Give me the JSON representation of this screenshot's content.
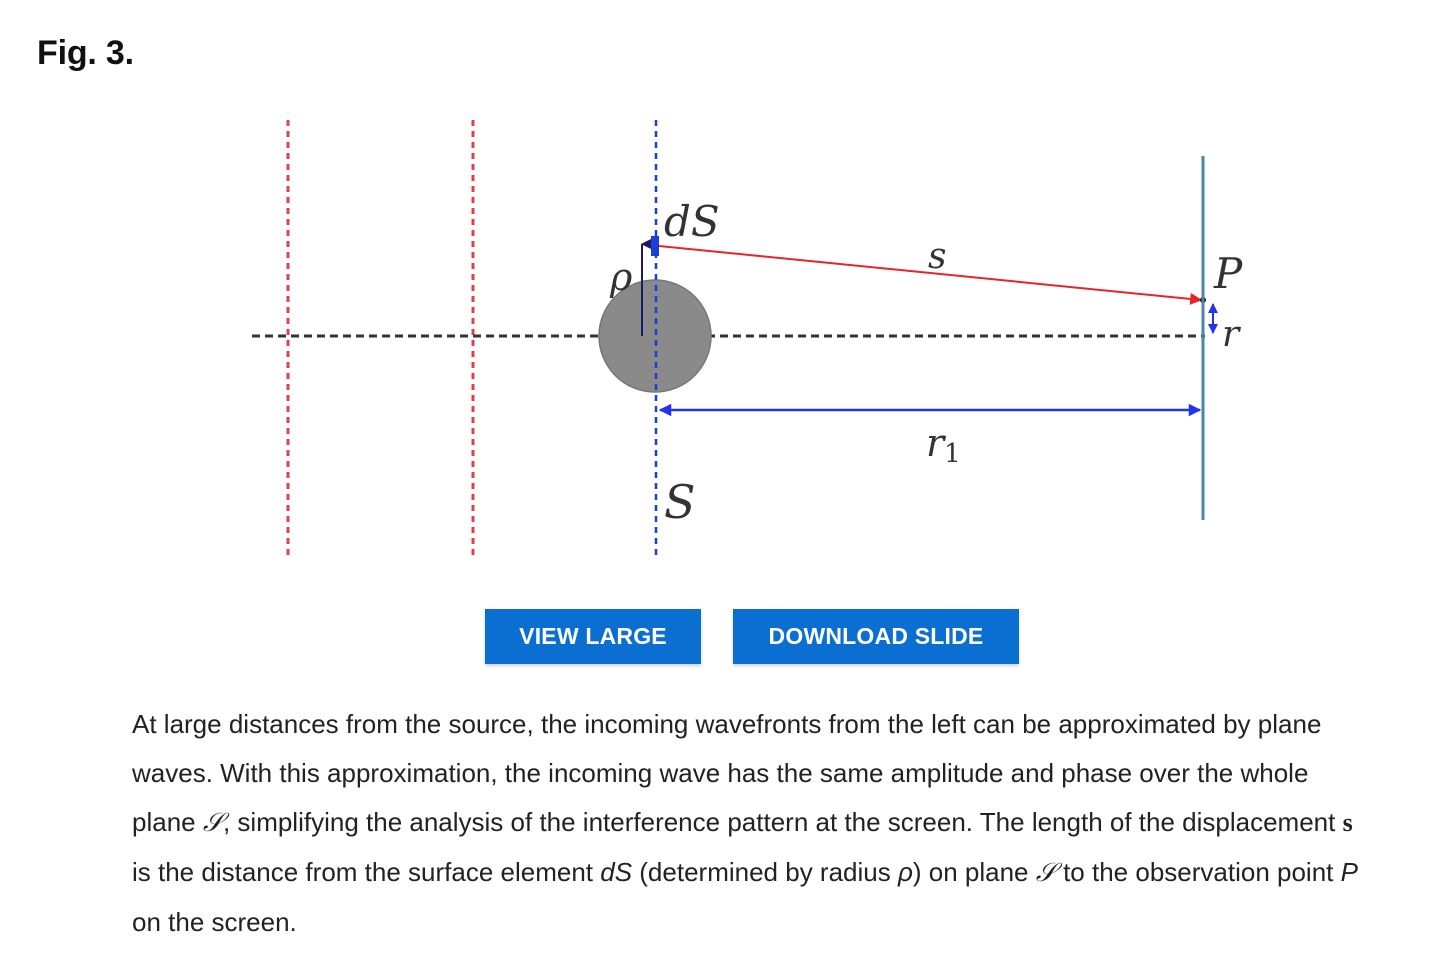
{
  "figure": {
    "title": "Fig. 3.",
    "labels": {
      "dS": "dS",
      "s": "s",
      "P": "P",
      "rho": "ρ",
      "r": "r",
      "r1": "r",
      "r1_sub": "1",
      "S": "S"
    },
    "colors": {
      "wavefront": "#e0404a",
      "axis": "#333333",
      "plane": "#1a3fd6",
      "ray": "#e8232a",
      "distance": "#2233ee",
      "screen": "#4a86a8",
      "obstacle": "#8a8a8a"
    }
  },
  "buttons": {
    "view_large": "VIEW LARGE",
    "download_slide": "DOWNLOAD SLIDE"
  },
  "caption": {
    "p1": "At large distances from the source, the incoming wavefronts from the left can be approximated by plane waves. With this approximation, the incoming wave has the same amplitude and phase over the whole plane ",
    "plane_symbol": "𝒮",
    "p2": ", simplifying the analysis of the interference pattern at the screen. The length of the displacement ",
    "s_bold": "s",
    "p3": " is the distance from the surface element ",
    "dS": "dS",
    "p4": " (determined by radius ",
    "rho": "ρ",
    "p5": ") on plane ",
    "plane_symbol2": "𝒮",
    "p6": " to the observation point ",
    "P": "P",
    "p7": " on the screen."
  }
}
